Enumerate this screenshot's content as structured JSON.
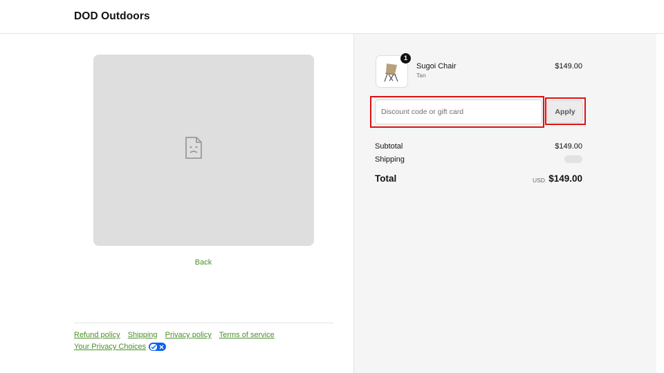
{
  "header": {
    "brand": "DOD Outdoors"
  },
  "main": {
    "back_label": "Back"
  },
  "footer": {
    "links": [
      "Refund policy",
      "Shipping",
      "Privacy policy",
      "Terms of service"
    ],
    "privacy_choices": "Your Privacy Choices"
  },
  "order": {
    "quantity_badge": "1",
    "item_name": "Sugoi Chair",
    "item_variant": "Tan",
    "item_price": "$149.00",
    "thumbnail_icon": "folding-chair-image"
  },
  "discount": {
    "placeholder": "Discount code or gift card",
    "value": "",
    "apply_label": "Apply"
  },
  "summary": {
    "subtotal_label": "Subtotal",
    "subtotal_value": "$149.00",
    "shipping_label": "Shipping",
    "total_label": "Total",
    "total_currency": "USD",
    "total_value": "$149.00"
  },
  "icons": {
    "preview": "broken-image-icon",
    "privacy_toggle": "privacy-choices-toggle-icon"
  },
  "colors": {
    "link": "#4a8f2a",
    "highlight": "#e01010",
    "privacy_blue": "#0b62f0"
  }
}
